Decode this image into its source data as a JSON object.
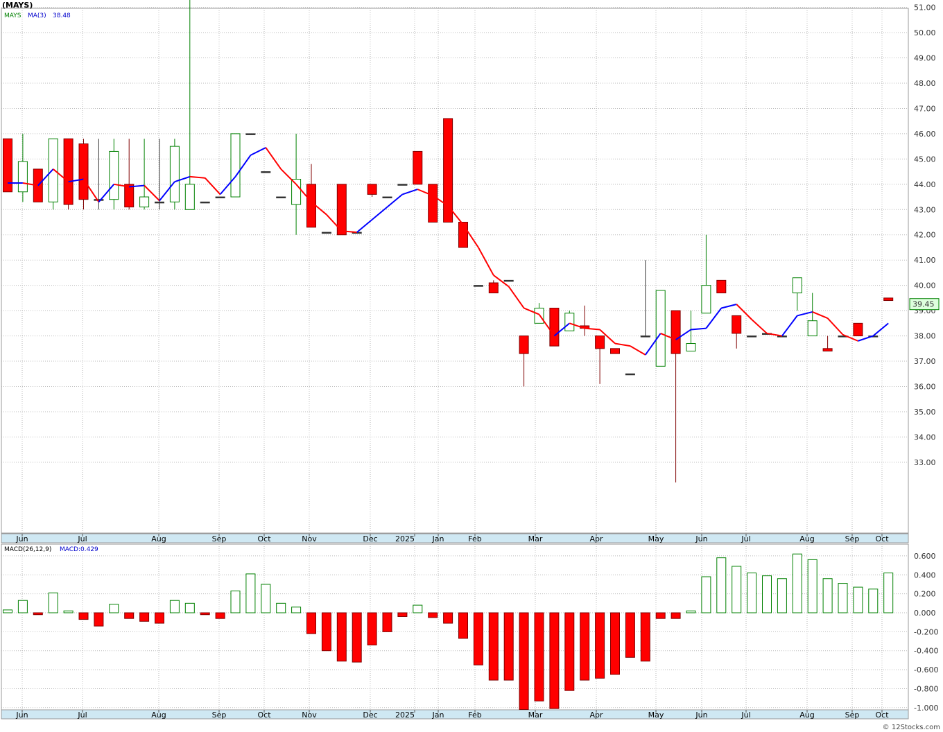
{
  "title": "(MAYS)",
  "legend": {
    "symbol": "MAYS",
    "ma_label": "MA(3)",
    "ma_value": "38.48"
  },
  "macd_legend": {
    "label": "MACD(26,12,9)",
    "value_label": "MACD:0.429"
  },
  "last_price_label": "39.45",
  "footer": "© 12Stocks.com",
  "colors": {
    "up": "#008000",
    "down": "#ff0000",
    "ma_up": "#0000ff",
    "ma_down": "#ff0000",
    "axis_band": "#cfe8f3",
    "grid": "#bbbbbb",
    "last_badge_bg": "#ddffdd"
  },
  "chart_data": [
    {
      "type": "candlestick",
      "period": "weekly",
      "ylim": [
        32.2,
        52.0
      ],
      "y_ticks": [
        "33.00",
        "34.00",
        "35.00",
        "36.00",
        "37.00",
        "38.00",
        "39.00",
        "40.00",
        "41.00",
        "42.00",
        "43.00",
        "44.00",
        "45.00",
        "46.00",
        "47.00",
        "48.00",
        "49.00",
        "50.00",
        "51.00"
      ],
      "x_labels": [
        "Jun",
        "Jul",
        "Aug",
        "Sep",
        "Oct",
        "Nov",
        "Dec",
        "2025",
        "Jan",
        "Feb",
        "Mar",
        "Apr",
        "May",
        "Jun",
        "Jul",
        "Aug",
        "Sep",
        "Oct"
      ],
      "grid": true,
      "series": [
        {
          "name": "MAYS",
          "ohlc": [
            [
              45.8,
              45.8,
              43.7,
              43.7
            ],
            [
              43.7,
              46.0,
              43.3,
              44.9
            ],
            [
              44.6,
              44.6,
              43.3,
              43.3
            ],
            [
              43.3,
              45.8,
              43.0,
              45.8
            ],
            [
              45.8,
              45.8,
              43.0,
              43.2
            ],
            [
              45.6,
              45.8,
              43.0,
              43.4
            ],
            [
              43.4,
              45.8,
              43.0,
              43.4
            ],
            [
              43.4,
              45.8,
              43.0,
              45.3
            ],
            [
              44.0,
              45.8,
              43.0,
              43.1
            ],
            [
              43.1,
              45.8,
              43.0,
              43.5
            ],
            [
              43.3,
              45.8,
              43.0,
              43.3
            ],
            [
              43.3,
              45.8,
              43.0,
              45.5
            ],
            [
              43.0,
              51.6,
              43.0,
              44.0
            ],
            [
              43.3,
              43.3,
              43.3,
              43.3
            ],
            [
              43.5,
              43.5,
              43.5,
              43.5
            ],
            [
              43.5,
              46.0,
              43.5,
              46.0
            ],
            [
              46.0,
              46.0,
              46.0,
              46.0
            ],
            [
              44.5,
              44.5,
              44.5,
              44.5
            ],
            [
              43.5,
              43.5,
              43.5,
              43.5
            ],
            [
              43.2,
              46.0,
              42.0,
              44.2
            ],
            [
              44.0,
              44.8,
              42.3,
              42.3
            ],
            [
              42.1,
              42.1,
              42.1,
              42.1
            ],
            [
              44.0,
              44.0,
              42.0,
              42.0
            ],
            [
              42.1,
              42.1,
              42.1,
              42.1
            ],
            [
              44.0,
              44.0,
              43.5,
              43.6
            ],
            [
              43.5,
              43.5,
              43.5,
              43.5
            ],
            [
              44.0,
              44.0,
              44.0,
              44.0
            ],
            [
              45.3,
              45.3,
              44.0,
              44.0
            ],
            [
              44.0,
              44.0,
              42.5,
              42.5
            ],
            [
              46.6,
              46.6,
              42.5,
              42.5
            ],
            [
              42.5,
              42.5,
              41.5,
              41.5
            ],
            [
              40.0,
              40.0,
              40.0,
              40.0
            ],
            [
              40.1,
              40.2,
              39.7,
              39.7
            ],
            [
              40.2,
              40.2,
              40.2,
              40.2
            ],
            [
              38.0,
              38.0,
              36.0,
              37.3
            ],
            [
              38.5,
              39.3,
              38.5,
              39.1
            ],
            [
              39.1,
              39.1,
              37.6,
              37.6
            ],
            [
              38.2,
              39.0,
              38.2,
              38.9
            ],
            [
              38.4,
              39.2,
              38.0,
              38.3
            ],
            [
              38.0,
              38.0,
              36.1,
              37.5
            ],
            [
              37.5,
              37.5,
              37.3,
              37.3
            ],
            [
              36.5,
              36.5,
              36.5,
              36.5
            ],
            [
              38.0,
              41.0,
              38.0,
              38.0
            ],
            [
              36.8,
              39.8,
              36.8,
              39.8
            ],
            [
              39.0,
              39.0,
              32.2,
              37.3
            ],
            [
              37.4,
              39.0,
              37.4,
              37.7
            ],
            [
              38.9,
              42.0,
              38.9,
              40.0
            ],
            [
              40.2,
              40.2,
              39.7,
              39.7
            ],
            [
              38.8,
              38.8,
              37.5,
              38.1
            ],
            [
              38.0,
              38.0,
              38.0,
              38.0
            ],
            [
              38.1,
              38.1,
              38.1,
              38.1
            ],
            [
              38.0,
              38.0,
              38.0,
              38.0
            ],
            [
              39.7,
              40.3,
              39.0,
              40.3
            ],
            [
              38.0,
              39.7,
              38.0,
              38.6
            ],
            [
              37.5,
              38.0,
              37.4,
              37.4
            ],
            [
              38.0,
              38.0,
              38.0,
              38.0
            ],
            [
              38.5,
              38.5,
              38.0,
              38.0
            ],
            [
              38.0,
              38.0,
              38.0,
              38.0
            ],
            [
              39.5,
              39.5,
              39.4,
              39.4
            ]
          ]
        },
        {
          "name": "MA(3)",
          "values": [
            44.05,
            44.05,
            43.95,
            44.6,
            44.1,
            44.2,
            43.3,
            44.0,
            43.9,
            43.95,
            43.35,
            44.1,
            44.3,
            44.25,
            43.6,
            44.3,
            45.15,
            45.45,
            44.6,
            44.0,
            43.3,
            42.8,
            42.15,
            42.1,
            42.6,
            43.1,
            43.6,
            43.8,
            43.55,
            43.15,
            42.4,
            41.5,
            40.4,
            39.95,
            39.1,
            38.85,
            38.0,
            38.5,
            38.3,
            38.25,
            37.7,
            37.6,
            37.25,
            38.1,
            37.85,
            38.25,
            38.3,
            39.1,
            39.25,
            38.65,
            38.1,
            38.0,
            38.8,
            38.95,
            38.7,
            38.05,
            37.8,
            38.0,
            38.5
          ]
        }
      ]
    },
    {
      "type": "bar",
      "name": "MACD(26,12,9)",
      "ylim": [
        -1.03,
        0.66
      ],
      "y_ticks": [
        "-1.000",
        "-0.800",
        "-0.600",
        "-0.400",
        "-0.200",
        "0.000",
        "0.200",
        "0.400",
        "0.600"
      ],
      "x_labels": [
        "Jun",
        "Jul",
        "Aug",
        "Sep",
        "Oct",
        "Nov",
        "Dec",
        "2025",
        "Jan",
        "Feb",
        "Mar",
        "Apr",
        "May",
        "Jun",
        "Jul",
        "Aug",
        "Sep",
        "Oct"
      ],
      "values": [
        0.03,
        0.13,
        -0.02,
        0.21,
        0.02,
        -0.07,
        -0.14,
        0.09,
        -0.06,
        -0.09,
        -0.11,
        0.13,
        0.1,
        -0.02,
        -0.06,
        0.23,
        0.41,
        0.3,
        0.1,
        0.06,
        -0.22,
        -0.4,
        -0.51,
        -0.52,
        -0.34,
        -0.2,
        -0.04,
        0.08,
        -0.05,
        -0.11,
        -0.27,
        -0.55,
        -0.71,
        -0.71,
        -1.02,
        -0.93,
        -1.01,
        -0.82,
        -0.71,
        -0.69,
        -0.65,
        -0.47,
        -0.51,
        -0.06,
        -0.06,
        0.02,
        0.38,
        0.58,
        0.49,
        0.42,
        0.39,
        0.36,
        0.62,
        0.56,
        0.36,
        0.31,
        0.27,
        0.25,
        0.42
      ]
    }
  ]
}
